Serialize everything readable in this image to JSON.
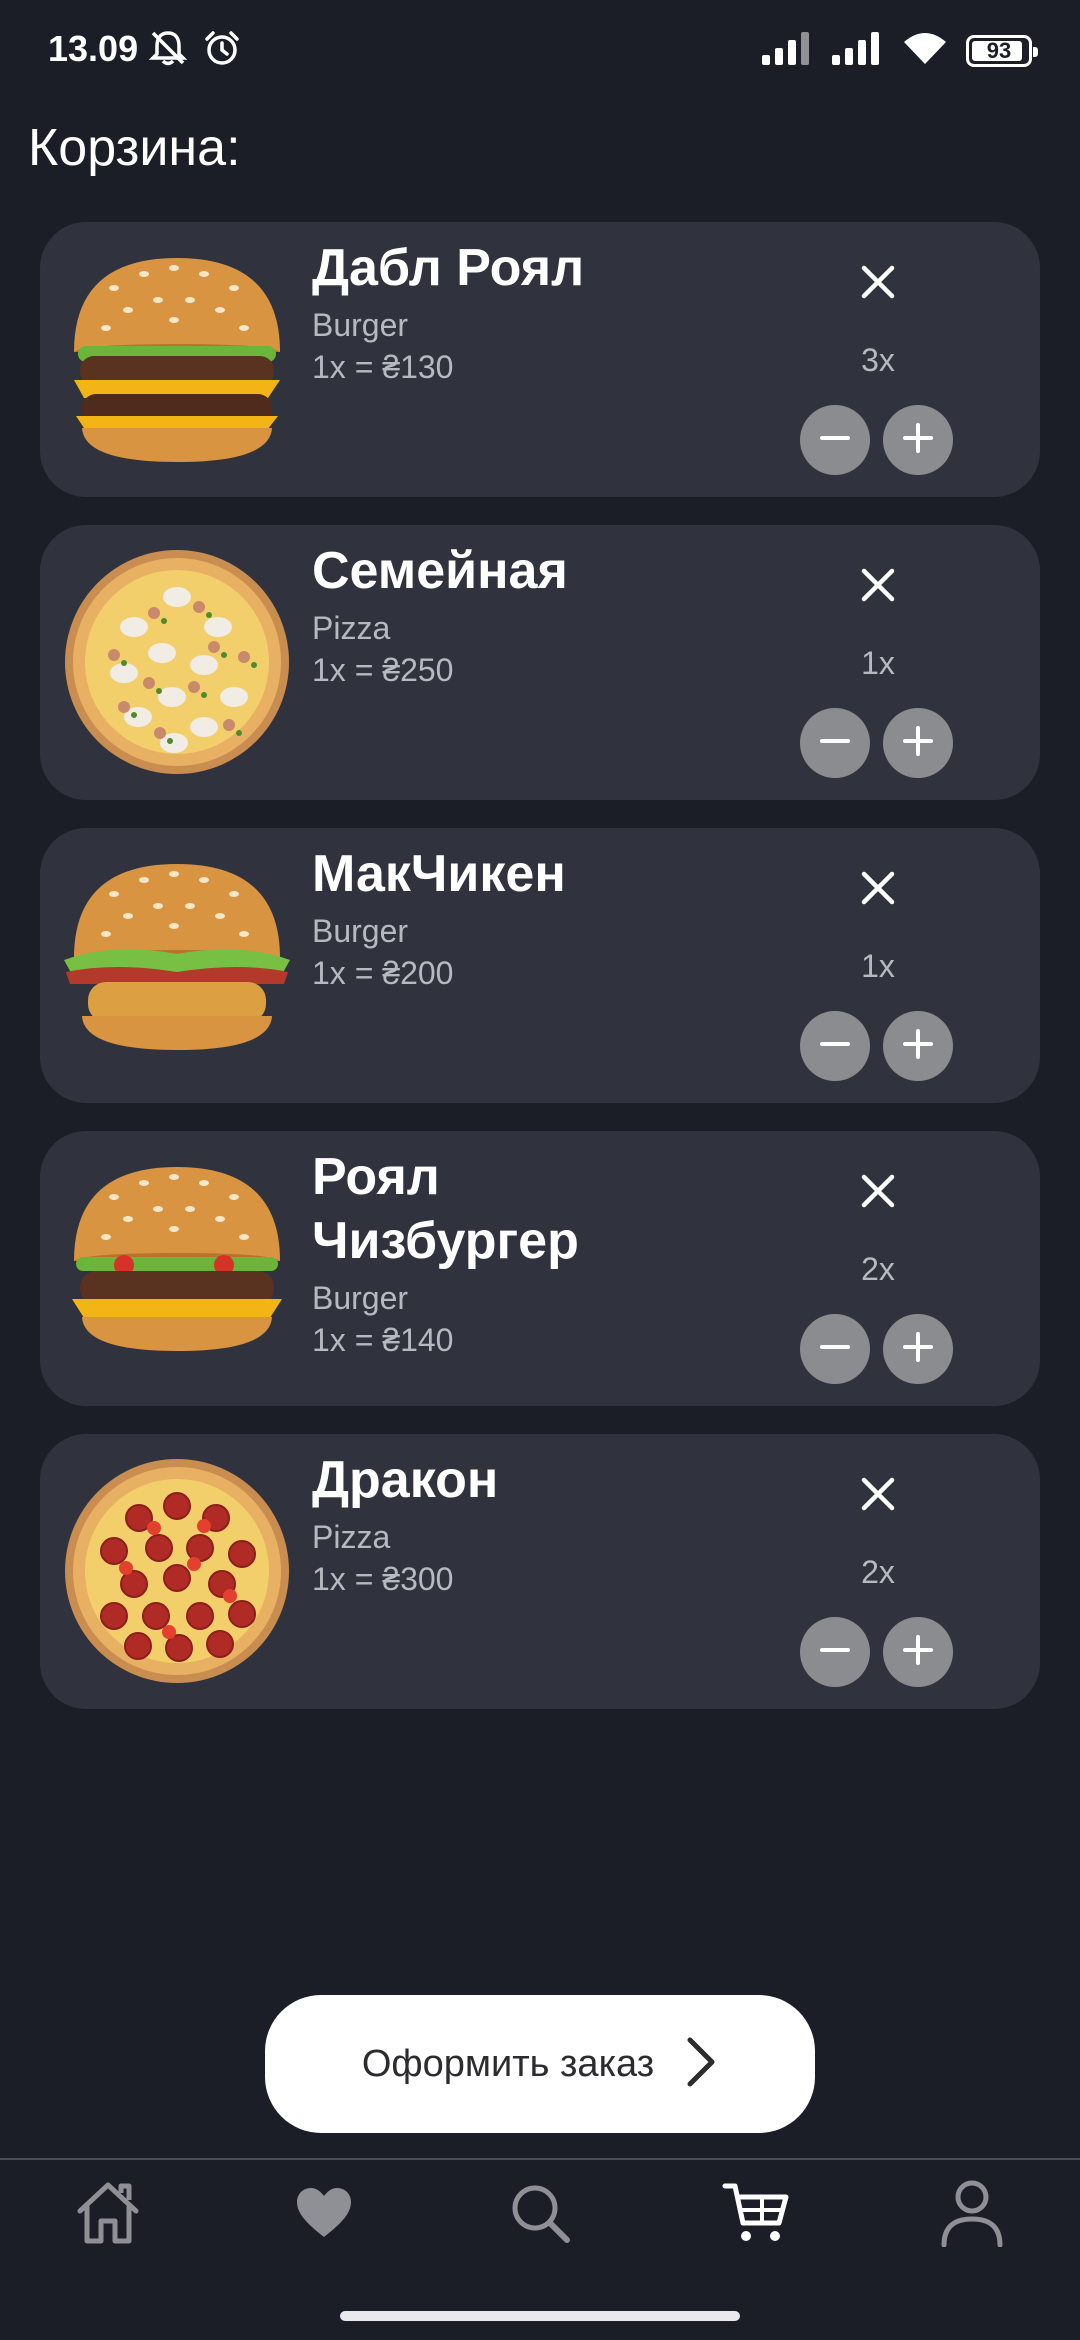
{
  "status_bar": {
    "time": "13.09",
    "battery_level": 93,
    "battery_text": "93",
    "icons": [
      "bell-muted-icon",
      "alarm-icon",
      "signal-icon",
      "signal-icon",
      "wifi-icon",
      "battery-icon"
    ]
  },
  "page_title": "Корзина:",
  "cart_items": [
    {
      "name": "Дабл Роял",
      "category": "Burger",
      "price": "1x = ₴130",
      "quantity": "3x",
      "image": "double-burger"
    },
    {
      "name": "Семейная",
      "category": "Pizza",
      "price": "1x = ₴250",
      "quantity": "1x",
      "image": "family-pizza"
    },
    {
      "name": "МакЧикен",
      "category": "Burger",
      "price": "1x = ₴200",
      "quantity": "1x",
      "image": "chicken-burger"
    },
    {
      "name": "Роял Чизбургер",
      "category": "Burger",
      "price": "1x = ₴140",
      "quantity": "2x",
      "image": "cheeseburger"
    },
    {
      "name": "Дракон",
      "category": "Pizza",
      "price": "1x = ₴300",
      "quantity": "2x",
      "image": "pepperoni-pizza"
    }
  ],
  "checkout": {
    "label": "Оформить заказ",
    "icon": "chevron-right-icon"
  },
  "bottom_nav": {
    "items": [
      {
        "icon": "home-icon",
        "active": false
      },
      {
        "icon": "heart-icon",
        "active": false
      },
      {
        "icon": "search-icon",
        "active": false
      },
      {
        "icon": "cart-icon",
        "active": true
      },
      {
        "icon": "profile-icon",
        "active": false
      }
    ]
  },
  "colors": {
    "background": "#1b1e27",
    "card": "#30333e",
    "inactive_icon": "#8f9096",
    "active_icon": "#ffffff"
  }
}
